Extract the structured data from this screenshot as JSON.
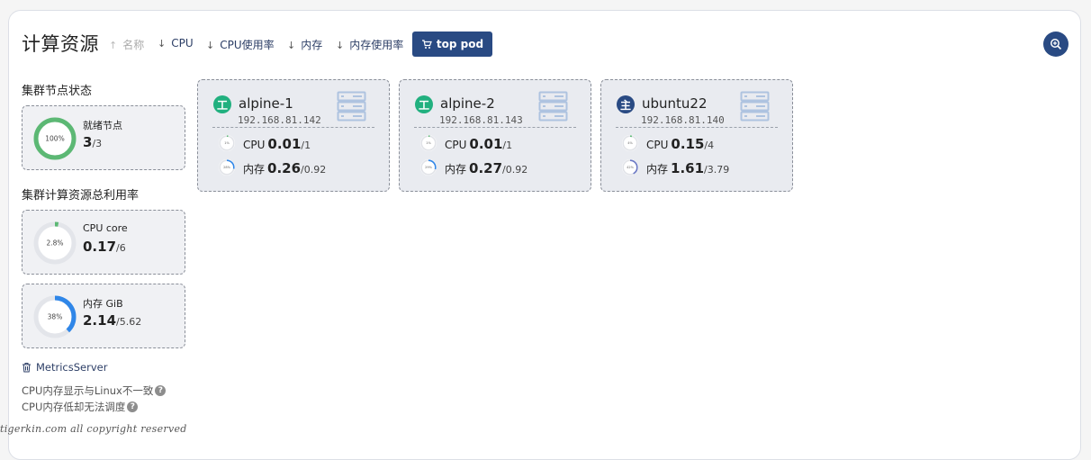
{
  "header": {
    "title": "计算资源",
    "sorts": [
      {
        "label": "名称",
        "active": false
      },
      {
        "label": "CPU",
        "active": true
      },
      {
        "label": "CPU使用率",
        "active": true
      },
      {
        "label": "内存",
        "active": true
      },
      {
        "label": "内存使用率",
        "active": true
      }
    ],
    "top_pod_label": "top pod"
  },
  "sidebar": {
    "cluster_status_title": "集群节点状态",
    "ready_nodes": {
      "label": "就绪节点",
      "value": "3",
      "total": "/3",
      "ring_text": "100%",
      "fraction": 1.0,
      "color": "#5cb874"
    },
    "usage_title": "集群计算资源总利用率",
    "cpu": {
      "label": "CPU core",
      "value": "0.17",
      "total": "/6",
      "ring_text": "2.8%",
      "fraction": 0.028,
      "color": "#5cb874"
    },
    "memory": {
      "label": "内存 GiB",
      "value": "2.14",
      "total": "/5.62",
      "ring_text": "38%",
      "fraction": 0.38,
      "color": "#2f86e8"
    },
    "metrics_server_label": "MetricsServer",
    "note1": "CPU内存显示与Linux不一致",
    "note2": "CPU内存低却无法调度",
    "help_glyph": "?"
  },
  "watermark": "tigerkin.com all copyright reserved",
  "nodes": [
    {
      "badge": "工",
      "badge_color": "#21b07f",
      "name": "alpine-1",
      "ip": "192.168.81.142",
      "cpu_label": "CPU",
      "cpu_value": "0.01",
      "cpu_total": "/1",
      "cpu_ring_text": "1%",
      "cpu_fraction": 0.01,
      "mem_label": "内存",
      "mem_value": "0.26",
      "mem_total": "/0.92",
      "mem_ring_text": "28%",
      "mem_fraction": 0.28
    },
    {
      "badge": "工",
      "badge_color": "#21b07f",
      "name": "alpine-2",
      "ip": "192.168.81.143",
      "cpu_label": "CPU",
      "cpu_value": "0.01",
      "cpu_total": "/1",
      "cpu_ring_text": "1%",
      "cpu_fraction": 0.01,
      "mem_label": "内存",
      "mem_value": "0.27",
      "mem_total": "/0.92",
      "mem_ring_text": "29%",
      "mem_fraction": 0.29
    },
    {
      "badge": "主",
      "badge_color": "#294a83",
      "name": "ubuntu22",
      "ip": "192.168.81.140",
      "cpu_label": "CPU",
      "cpu_value": "0.15",
      "cpu_total": "/4",
      "cpu_ring_text": "4%",
      "cpu_fraction": 0.04,
      "mem_label": "内存",
      "mem_value": "1.61",
      "mem_total": "/3.79",
      "mem_ring_text": "42%",
      "mem_fraction": 0.42
    }
  ]
}
